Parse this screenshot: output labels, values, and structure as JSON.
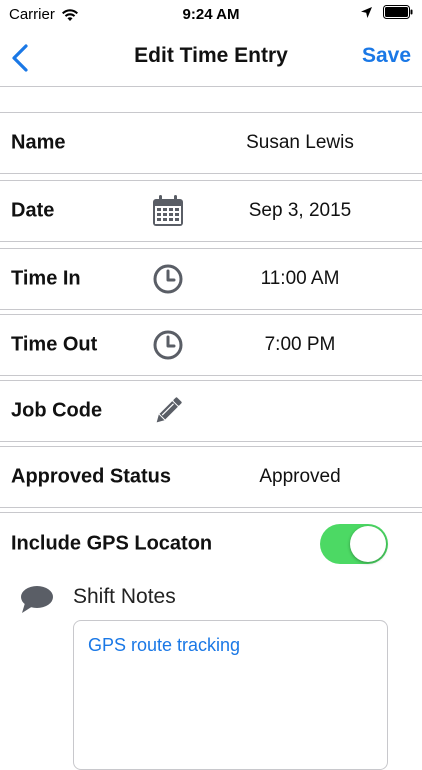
{
  "status_bar": {
    "carrier": "Carrier",
    "time": "9:24 AM"
  },
  "nav": {
    "title": "Edit Time Entry",
    "save_label": "Save"
  },
  "rows": [
    {
      "label": "Name",
      "value": "Susan Lewis",
      "icon": ""
    },
    {
      "label": "Date",
      "value": "Sep 3, 2015",
      "icon": "calendar-icon"
    },
    {
      "label": "Time In",
      "value": "11:00 AM",
      "icon": "clock-icon"
    },
    {
      "label": "Time Out",
      "value": "7:00 PM",
      "icon": "clock-icon"
    },
    {
      "label": "Job Code",
      "value": "",
      "icon": "pencil-icon"
    },
    {
      "label": "Approved Status",
      "value": "Approved",
      "icon": ""
    }
  ],
  "gps": {
    "label": "Include GPS Locaton",
    "enabled": true
  },
  "notes": {
    "label": "Shift Notes",
    "text": "GPS route tracking"
  },
  "colors": {
    "accent": "#1a78e6",
    "toggle_on": "#4cd964",
    "icon_gray": "#5a5e66"
  }
}
